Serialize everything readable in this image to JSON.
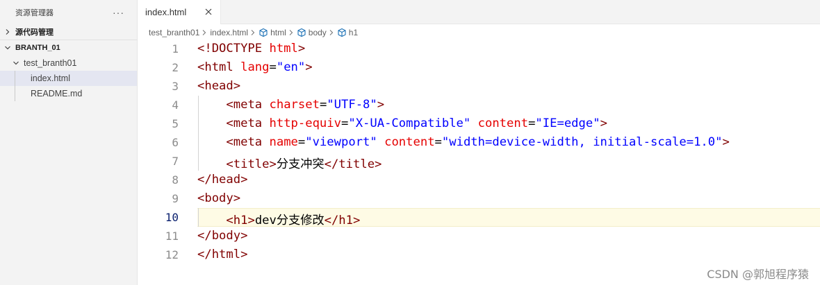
{
  "sidebar": {
    "title": "资源管理器",
    "more": "···",
    "sections": {
      "scm": "源代码管理",
      "workspace": "BRANTH_01"
    },
    "folder": "test_branth01",
    "files": [
      "index.html",
      "README.md"
    ]
  },
  "tabs": [
    {
      "label": "index.html",
      "active": true
    }
  ],
  "breadcrumb": {
    "items": [
      "test_branth01",
      "index.html",
      "html",
      "body",
      "h1"
    ]
  },
  "editor": {
    "current_line": 10,
    "lines": [
      {
        "n": "1",
        "tokens": [
          [
            "tag",
            "<!DOCTYPE "
          ],
          [
            "attr",
            "html"
          ],
          [
            "tag",
            ">"
          ]
        ]
      },
      {
        "n": "2",
        "tokens": [
          [
            "tag",
            "<html "
          ],
          [
            "attr",
            "lang"
          ],
          [
            "txt",
            "="
          ],
          [
            "val",
            "\"en\""
          ],
          [
            "tag",
            ">"
          ]
        ]
      },
      {
        "n": "3",
        "tokens": [
          [
            "tag",
            "<head>"
          ]
        ]
      },
      {
        "n": "4",
        "indent": true,
        "tokens": [
          [
            "txt",
            "    "
          ],
          [
            "tag",
            "<meta "
          ],
          [
            "attr",
            "charset"
          ],
          [
            "txt",
            "="
          ],
          [
            "val",
            "\"UTF-8\""
          ],
          [
            "tag",
            ">"
          ]
        ]
      },
      {
        "n": "5",
        "indent": true,
        "tokens": [
          [
            "txt",
            "    "
          ],
          [
            "tag",
            "<meta "
          ],
          [
            "attr",
            "http-equiv"
          ],
          [
            "txt",
            "="
          ],
          [
            "val",
            "\"X-UA-Compatible\""
          ],
          [
            "txt",
            " "
          ],
          [
            "attr",
            "content"
          ],
          [
            "txt",
            "="
          ],
          [
            "val",
            "\"IE=edge\""
          ],
          [
            "tag",
            ">"
          ]
        ]
      },
      {
        "n": "6",
        "indent": true,
        "tokens": [
          [
            "txt",
            "    "
          ],
          [
            "tag",
            "<meta "
          ],
          [
            "attr",
            "name"
          ],
          [
            "txt",
            "="
          ],
          [
            "val",
            "\"viewport\""
          ],
          [
            "txt",
            " "
          ],
          [
            "attr",
            "content"
          ],
          [
            "txt",
            "="
          ],
          [
            "val",
            "\"width=device-width, initial-scale=1.0\""
          ],
          [
            "tag",
            ">"
          ]
        ]
      },
      {
        "n": "7",
        "indent": true,
        "tokens": [
          [
            "txt",
            "    "
          ],
          [
            "tag",
            "<title>"
          ],
          [
            "txt",
            "分支冲突"
          ],
          [
            "tag",
            "</title>"
          ]
        ]
      },
      {
        "n": "8",
        "tokens": [
          [
            "tag",
            "</head>"
          ]
        ]
      },
      {
        "n": "9",
        "tokens": [
          [
            "tag",
            "<body>"
          ]
        ]
      },
      {
        "n": "10",
        "indent": true,
        "tokens": [
          [
            "txt",
            "    "
          ],
          [
            "tag",
            "<h1>"
          ],
          [
            "txt",
            "dev分支修改"
          ],
          [
            "tag",
            "</h1>"
          ]
        ]
      },
      {
        "n": "11",
        "tokens": [
          [
            "tag",
            "</body>"
          ]
        ]
      },
      {
        "n": "12",
        "tokens": [
          [
            "tag",
            "</html>"
          ]
        ]
      }
    ]
  },
  "watermark": "CSDN @郭旭程序猿",
  "colors": {
    "tag": "#800000",
    "attr": "#e50000",
    "value": "#0000ff",
    "current_line_bg": "#fefbe5",
    "selected_file_bg": "#e4e6f1"
  }
}
